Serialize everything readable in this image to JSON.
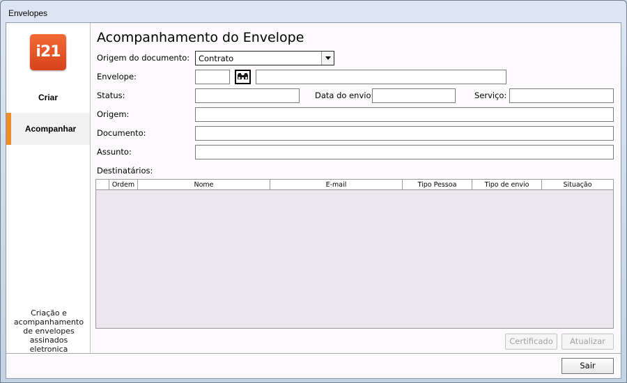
{
  "window": {
    "title": "Envelopes"
  },
  "sidebar": {
    "logo_text": "i21",
    "items": [
      {
        "label": "Criar"
      },
      {
        "label": "Acompanhar"
      }
    ],
    "description": "Criação e acompanhamento de envelopes assinados eletronica"
  },
  "main": {
    "title": "Acompanhamento do Envelope",
    "form": {
      "origem_documento_label": "Origem do documento:",
      "origem_documento_value": "Contrato",
      "envelope_label": "Envelope:",
      "envelope_id_value": "",
      "envelope_desc_value": "",
      "status_label": "Status:",
      "status_value": "",
      "data_envio_label": "Data do envio:",
      "data_envio_value": "",
      "servico_label": "Serviço:",
      "servico_value": "",
      "origem_label": "Origem:",
      "origem_value": "",
      "documento_label": "Documento:",
      "documento_value": "",
      "assunto_label": "Assunto:",
      "assunto_value": ""
    },
    "destinatarios_label": "Destinatários:",
    "grid_columns": [
      "",
      "Ordem",
      "Nome",
      "E-mail",
      "Tipo Pessoa",
      "Tipo de envio",
      "Situação"
    ],
    "buttons": {
      "certificado": "Certificado",
      "atualizar": "Atualizar"
    }
  },
  "footer": {
    "sair_label": "Sair"
  },
  "colors": {
    "accent": "#f28c28",
    "logo": "#e2522a"
  }
}
